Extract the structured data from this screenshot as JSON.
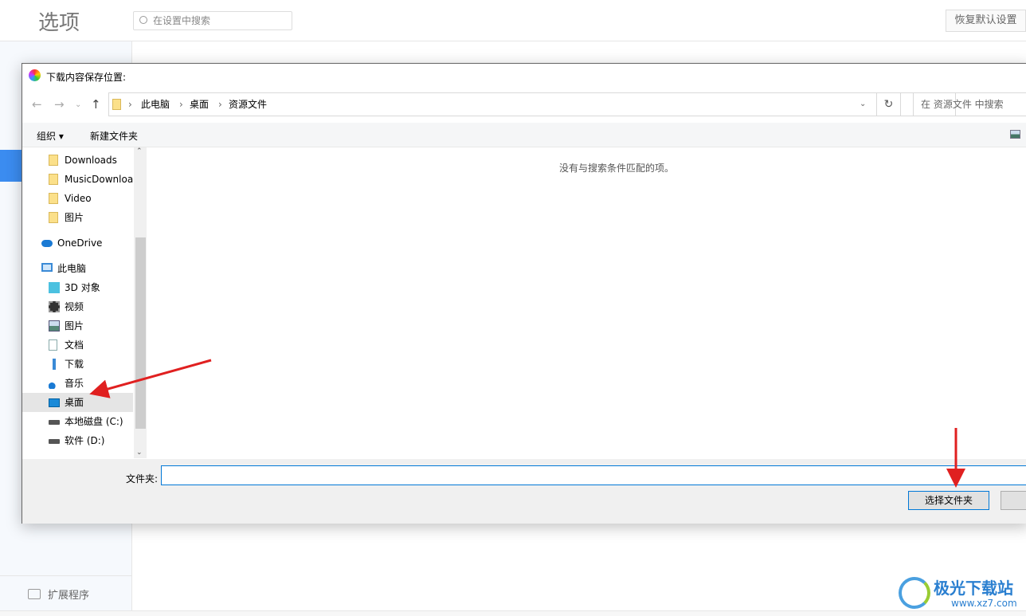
{
  "app": {
    "title": "选项",
    "search_placeholder": "在设置中搜索",
    "restore_button": "恢复默认设置",
    "extensions": "扩展程序"
  },
  "dialog": {
    "title": "下载内容保存位置:",
    "breadcrumb": [
      "此电脑",
      "桌面",
      "资源文件"
    ],
    "search_placeholder": "在 资源文件 中搜索",
    "toolbar": {
      "organize": "组织 ▾",
      "new_folder": "新建文件夹"
    },
    "tree": [
      {
        "label": "Downloads",
        "icon": "folder-icon"
      },
      {
        "label": "MusicDownloa",
        "icon": "folder-icon"
      },
      {
        "label": "Video",
        "icon": "folder-icon"
      },
      {
        "label": "图片",
        "icon": "folder-icon"
      },
      {
        "label": "OneDrive",
        "icon": "cloud-icon"
      },
      {
        "label": "此电脑",
        "icon": "computer-icon"
      },
      {
        "label": "3D 对象",
        "icon": "cube-icon"
      },
      {
        "label": "视频",
        "icon": "video-icon"
      },
      {
        "label": "图片",
        "icon": "picture-icon"
      },
      {
        "label": "文档",
        "icon": "document-icon"
      },
      {
        "label": "下载",
        "icon": "download-icon"
      },
      {
        "label": "音乐",
        "icon": "music-icon"
      },
      {
        "label": "桌面",
        "icon": "desktop-icon",
        "selected": true
      },
      {
        "label": "本地磁盘 (C:)",
        "icon": "drive-icon"
      },
      {
        "label": "软件 (D:)",
        "icon": "drive-icon"
      }
    ],
    "empty_message": "没有与搜索条件匹配的项。",
    "folder_label": "文件夹:",
    "folder_value": "",
    "select_button": "选择文件夹"
  },
  "watermark": {
    "name": "极光下载站",
    "url": "www.xz7.com"
  },
  "colors": {
    "accent": "#0078d7",
    "annotation_arrow": "#e02020",
    "sidebar_active": "#3b8cf0"
  }
}
